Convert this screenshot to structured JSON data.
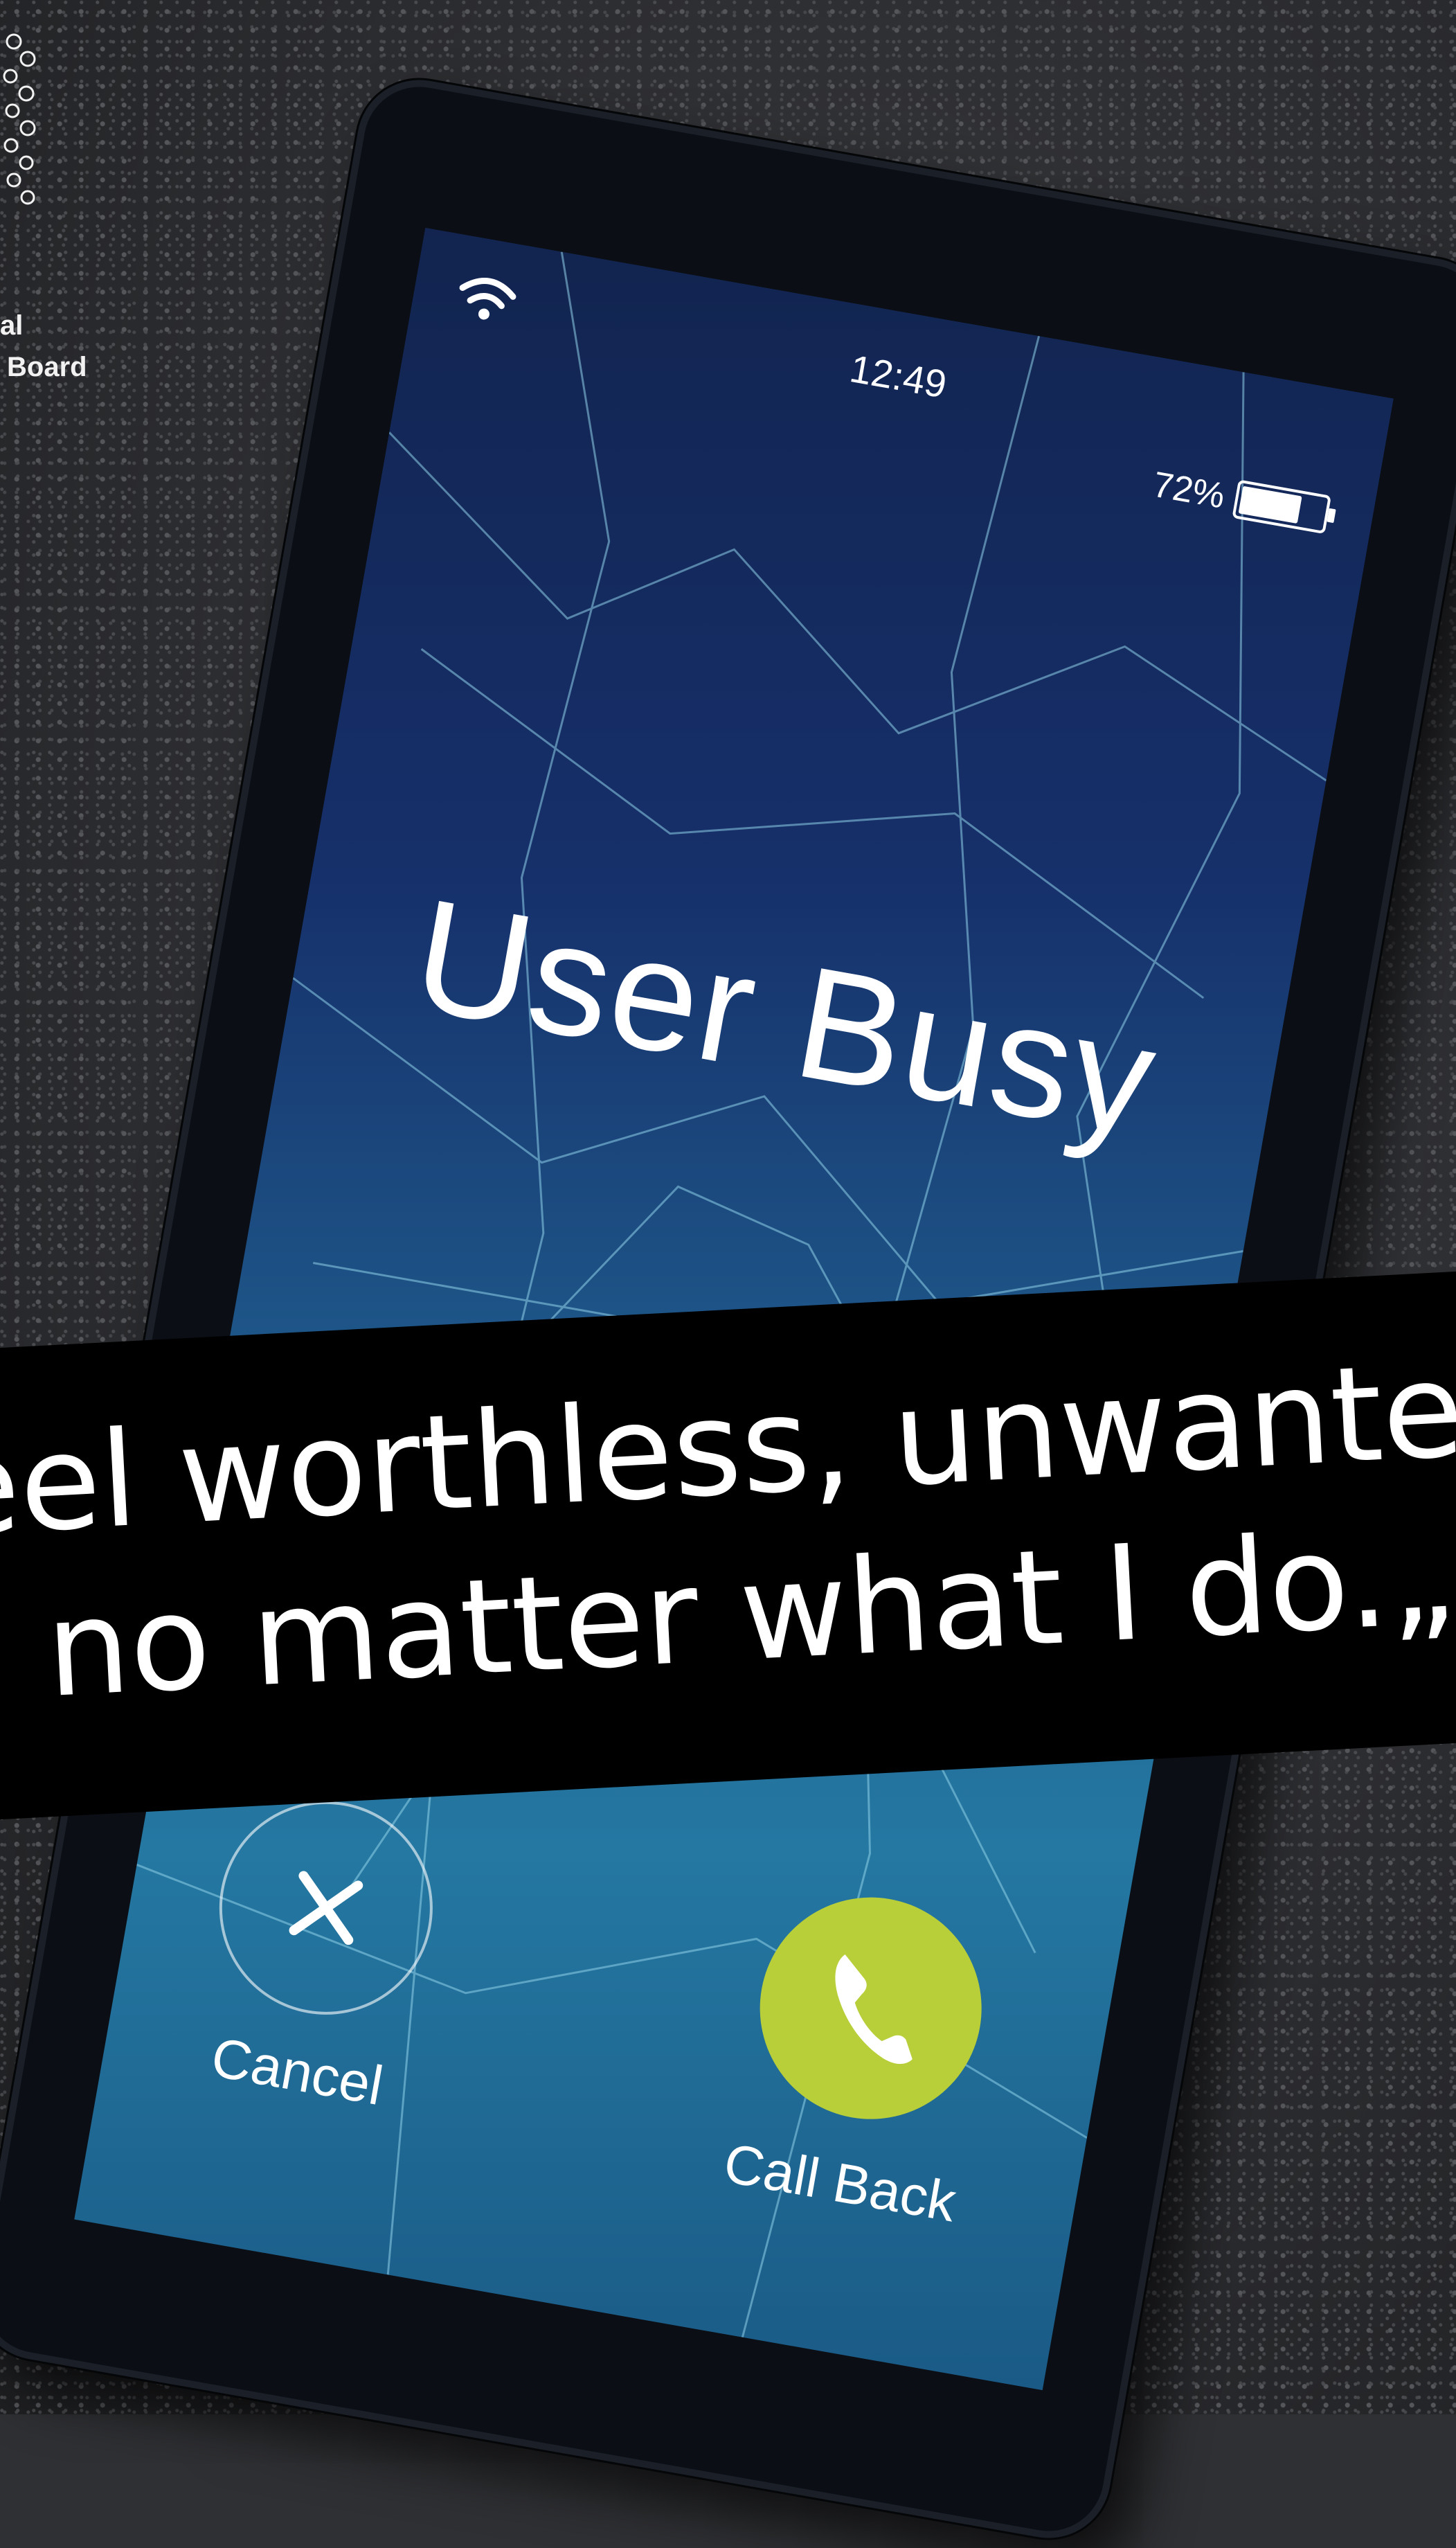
{
  "logo": {
    "line1": "al",
    "line2": "Board"
  },
  "phone": {
    "status_bar": {
      "time": "12:49",
      "battery_percent": "72%",
      "battery_level": 0.72,
      "wifi_icon": "wifi-icon"
    },
    "call_status": "User Busy",
    "actions": {
      "cancel_label": "Cancel",
      "callback_label": "Call Back",
      "callback_color": "#b9cf3a"
    }
  },
  "quote": {
    "line1": "eel worthless, unwanted",
    "line2": "no matter what I do.„"
  },
  "colors": {
    "banner": "#000000",
    "screen": "#1a3d7a"
  }
}
